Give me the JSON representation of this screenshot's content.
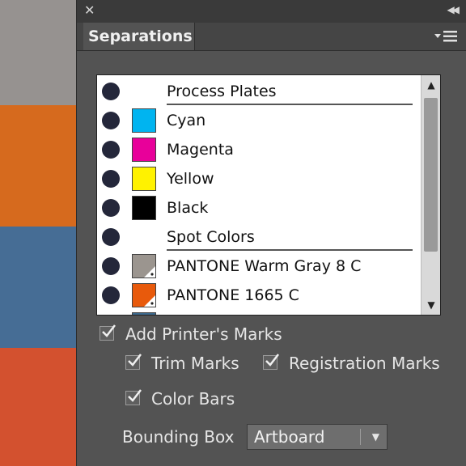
{
  "colors": {
    "bg_gray": "#969290",
    "bg_orange": "#d66a1e",
    "bg_blue": "#466d95",
    "bg_red": "#d3512f",
    "panel_bg": "#535353",
    "eye_dot": "#24273a"
  },
  "window": {
    "close_icon": "close-icon",
    "collapse_icon": "collapse-double-arrow-icon"
  },
  "panel": {
    "tab_label": "Separations",
    "menu_icon": "panel-menu-icon"
  },
  "separations": {
    "rows": [
      {
        "type": "header",
        "label": "Process Plates",
        "eye": true
      },
      {
        "type": "plate",
        "label": "Cyan",
        "swatch": "#00b4f0",
        "eye": true
      },
      {
        "type": "plate",
        "label": "Magenta",
        "swatch": "#e8009a",
        "eye": true
      },
      {
        "type": "plate",
        "label": "Yellow",
        "swatch": "#fff200",
        "eye": true
      },
      {
        "type": "plate",
        "label": "Black",
        "swatch": "#000000",
        "eye": true
      },
      {
        "type": "header",
        "label": "Spot Colors",
        "eye": true
      },
      {
        "type": "spot",
        "label": "PANTONE Warm Gray 8 C",
        "swatch": "#9b958f",
        "eye": true
      },
      {
        "type": "spot",
        "label": "PANTONE 1665 C",
        "swatch": "#e85a0c",
        "eye": true
      },
      {
        "type": "spot",
        "label": "",
        "swatch": "#3d6a8e",
        "eye": true
      }
    ]
  },
  "options": {
    "add_printers_marks": {
      "label": "Add Printer's Marks",
      "checked": true
    },
    "trim_marks": {
      "label": "Trim Marks",
      "checked": true
    },
    "registration_marks": {
      "label": "Registration Marks",
      "checked": true
    },
    "color_bars": {
      "label": "Color Bars",
      "checked": true
    }
  },
  "bounding_box": {
    "label": "Bounding Box",
    "value": "Artboard"
  }
}
